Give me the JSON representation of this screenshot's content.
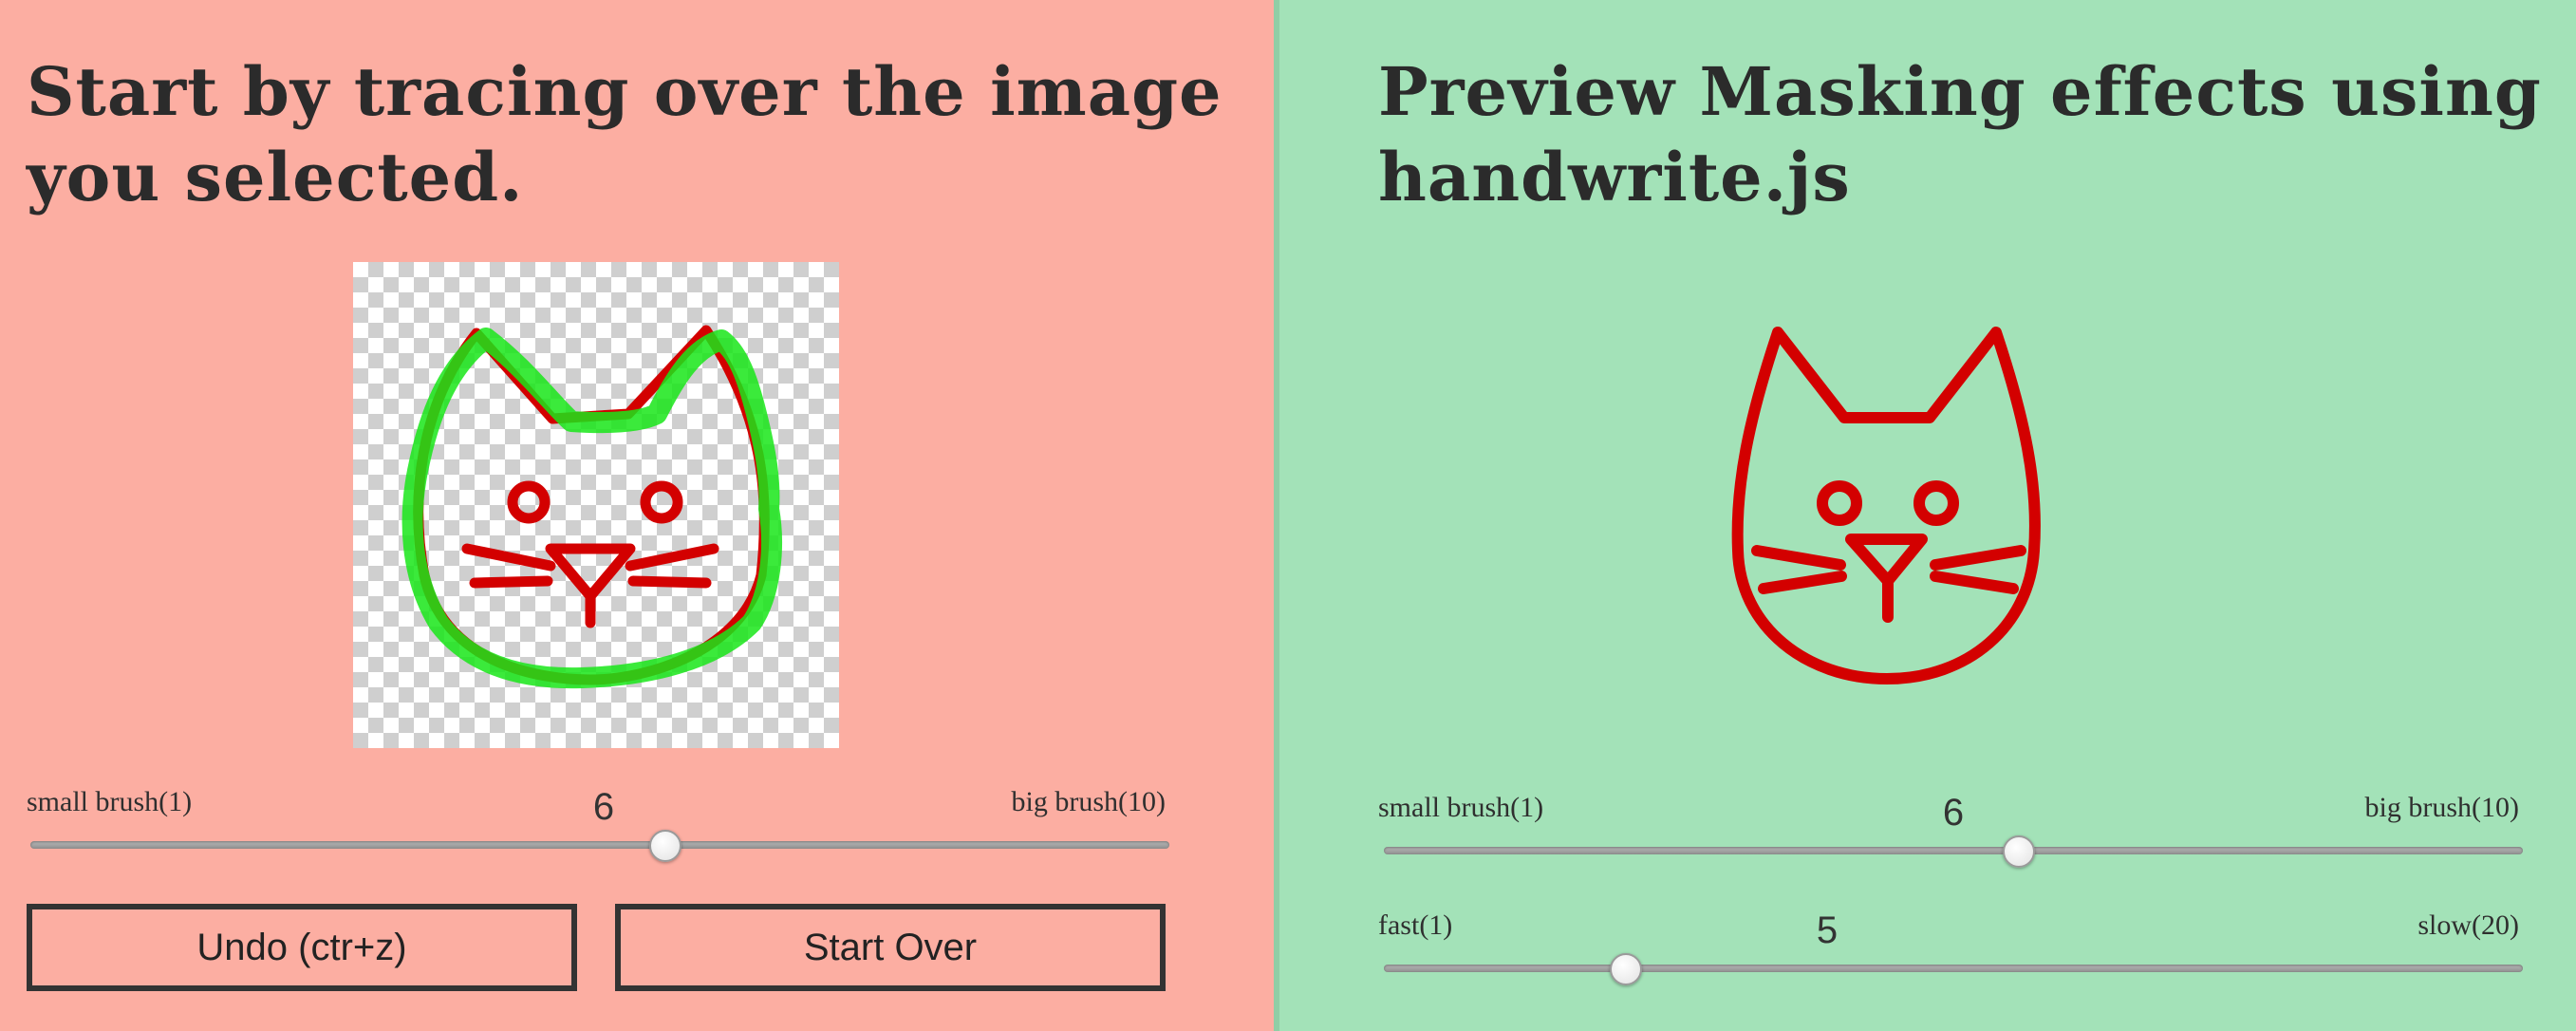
{
  "colors": {
    "left_bg": "#fcaea2",
    "right_bg": "#a3e2b8",
    "divider": "#8fcea6",
    "cat_red": "#d30000",
    "trace_green": "#19e619"
  },
  "left": {
    "title": "Start by tracing over the image you selected.",
    "brush": {
      "min_label": "small brush(1)",
      "max_label": "big brush(10)",
      "value_label": "6",
      "value": 6,
      "min": 1,
      "max": 10
    },
    "buttons": {
      "undo": "Undo (ctr+z)",
      "start_over": "Start Over"
    }
  },
  "right": {
    "title": "Preview Masking effects using handwrite.js",
    "brush": {
      "min_label": "small brush(1)",
      "max_label": "big brush(10)",
      "value_label": "6",
      "value": 6,
      "min": 1,
      "max": 10
    },
    "speed": {
      "min_label": "fast(1)",
      "max_label": "slow(20)",
      "value_label": "5",
      "value": 5,
      "min": 1,
      "max": 20
    }
  },
  "icons": {
    "cat": "cat-face-icon"
  }
}
